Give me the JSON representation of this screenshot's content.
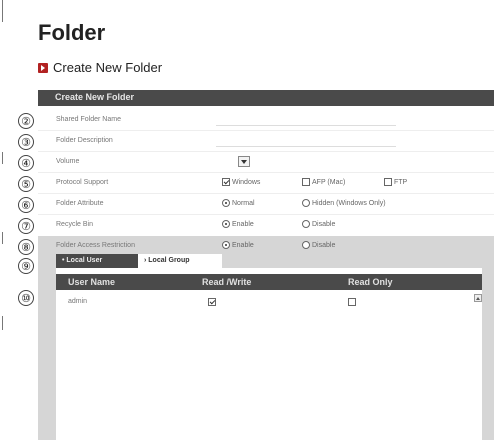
{
  "page": {
    "title": "Folder",
    "subtitle": "Create New Folder"
  },
  "panel": {
    "header": "Create New Folder"
  },
  "rows": [
    {
      "num": "②",
      "label": "Shared Folder Name"
    },
    {
      "num": "③",
      "label": "Folder Description"
    },
    {
      "num": "④",
      "label": "Volume"
    },
    {
      "num": "⑤",
      "label": "Protocol Support",
      "options": [
        "Windows",
        "AFP (Mac)",
        "FTP"
      ]
    },
    {
      "num": "⑥",
      "label": "Folder Attribute",
      "options": [
        "Normal",
        "Hidden (Windows Only)"
      ]
    },
    {
      "num": "⑦",
      "label": "Recycle Bin",
      "options": [
        "Enable",
        "Disable"
      ]
    },
    {
      "num": "⑧",
      "label": "Folder Access Restriction",
      "options": [
        "Enable",
        "Disable"
      ]
    }
  ],
  "tabs_num": "⑨",
  "tabs": [
    "• Local User",
    "› Local Group"
  ],
  "table": {
    "num": "⑩",
    "columns": [
      "User Name",
      "Read /Write",
      "Read Only"
    ],
    "rows": [
      {
        "user": "admin",
        "read_write": true,
        "read_only": false
      }
    ]
  }
}
